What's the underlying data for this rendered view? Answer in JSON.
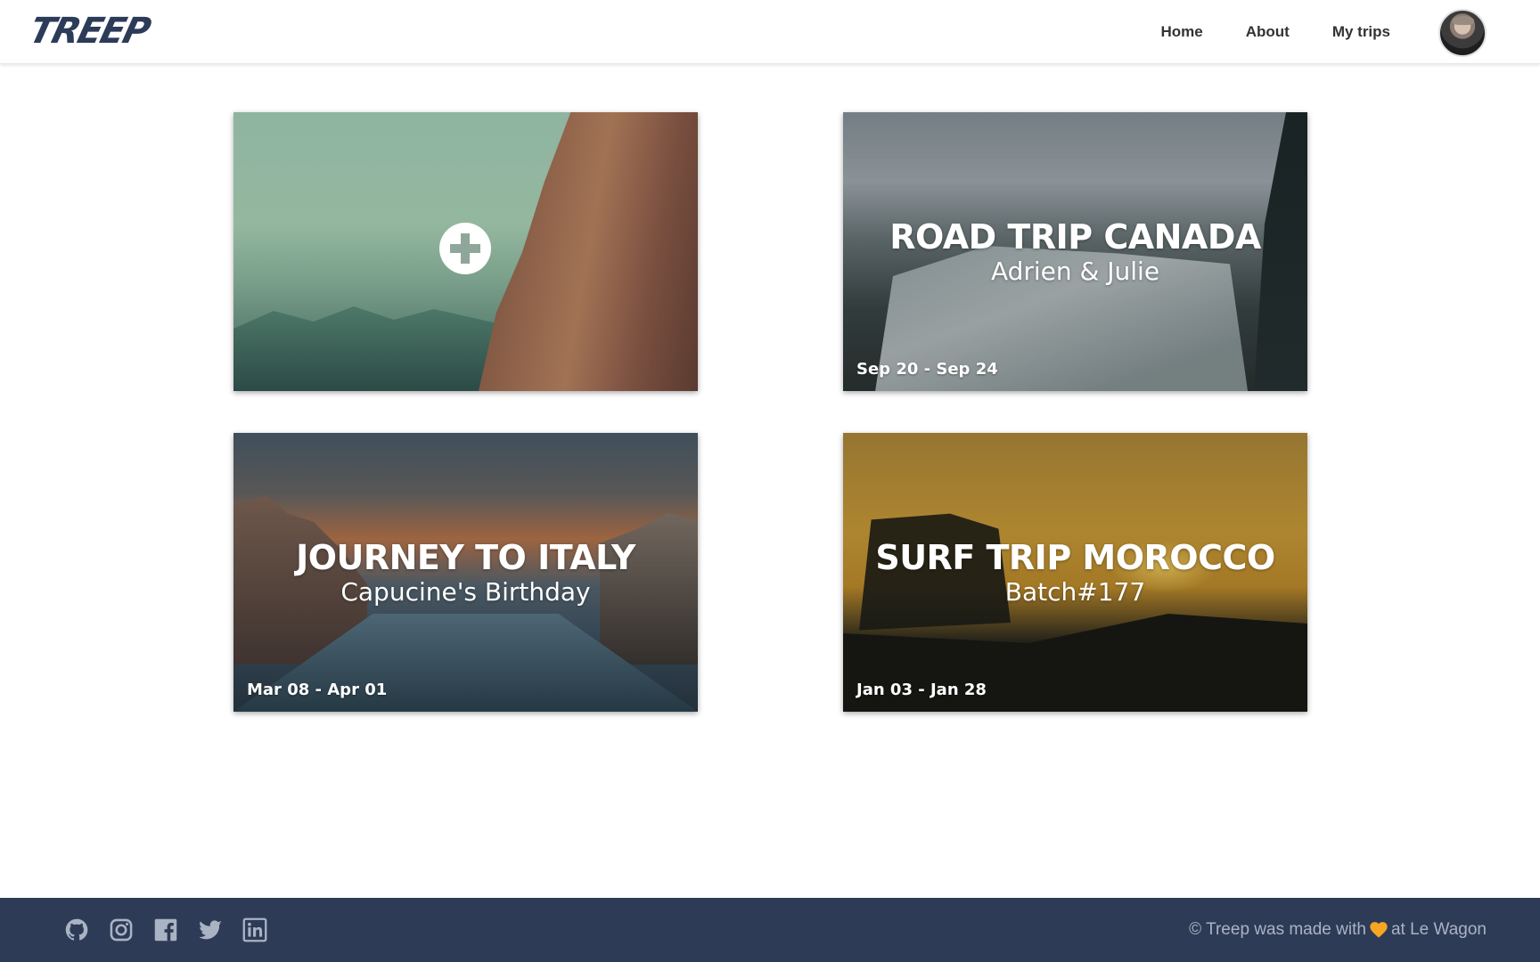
{
  "nav": {
    "logo": "TREEP",
    "links": [
      "Home",
      "About",
      "My trips"
    ]
  },
  "cards": [
    {
      "title": "",
      "subtitle": "",
      "dates": ""
    },
    {
      "title": "ROAD TRIP CANADA",
      "subtitle": "Adrien & Julie",
      "dates": "Sep 20 - Sep 24"
    },
    {
      "title": "JOURNEY TO ITALY",
      "subtitle": "Capucine's Birthday",
      "dates": "Mar 08 - Apr 01"
    },
    {
      "title": "SURF TRIP MOROCCO",
      "subtitle": "Batch#177",
      "dates": "Jan 03 - Jan 28"
    }
  ],
  "footer": {
    "social_icons": [
      "github-icon",
      "instagram-icon",
      "facebook-icon",
      "twitter-icon",
      "linkedin-icon"
    ],
    "text_before": "© Treep was made with",
    "text_after": "at Le Wagon",
    "heart_color": "#f5a623"
  },
  "colors": {
    "navy": "#2e3b56",
    "logo": "#2c3b58"
  }
}
